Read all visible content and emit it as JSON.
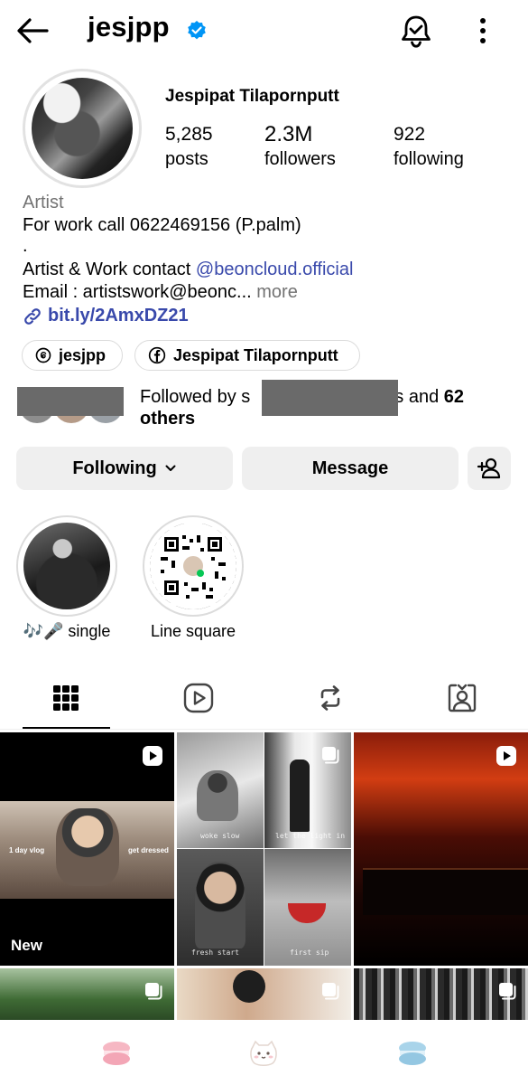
{
  "header": {
    "username": "jesjpp"
  },
  "profile": {
    "full_name": "Jespipat Tilapornputt",
    "stats": [
      {
        "num": "5,285",
        "label": "posts"
      },
      {
        "num": "2.3M",
        "label": "followers"
      },
      {
        "num": "922",
        "label": "following"
      }
    ],
    "category": "Artist",
    "bio_line1": "For work call 0622469156 (P.palm)",
    "bio_dot": ".",
    "bio_line3_prefix": "Artist & Work contact ",
    "bio_mention": "@beoncloud.official",
    "bio_line4": "Email : artistswork@beonc...",
    "bio_more": " more",
    "link": "bit.ly/2AmxDZ21"
  },
  "chips": {
    "threads": "jesjpp",
    "facebook": "Jespipat Tilapornputt"
  },
  "followed_by": {
    "prefix": "Followed by s",
    "suffix": "ss and ",
    "count": "62",
    "others": "others"
  },
  "buttons": {
    "following": "Following",
    "message": "Message"
  },
  "highlights": [
    {
      "label": "single",
      "emoji": "🎶🎤"
    },
    {
      "label": "Line square"
    }
  ],
  "grid": {
    "tile1_left_text": "1 day vlog",
    "tile1_right_text": "get dressed",
    "tile1_new": "New",
    "captions": [
      "woke slow",
      "let the light in",
      "fresh start",
      "first sip"
    ]
  },
  "icons": {
    "back": "arrow-left-icon",
    "verified": "verified-badge-icon",
    "bell": "notification-bell-icon",
    "more": "kebab-menu-icon",
    "add_user": "add-person-icon"
  },
  "colors": {
    "accent_link": "#3949ab",
    "verified_blue": "#0095f6",
    "button_bg": "#efefef",
    "muted_text": "#737373"
  }
}
